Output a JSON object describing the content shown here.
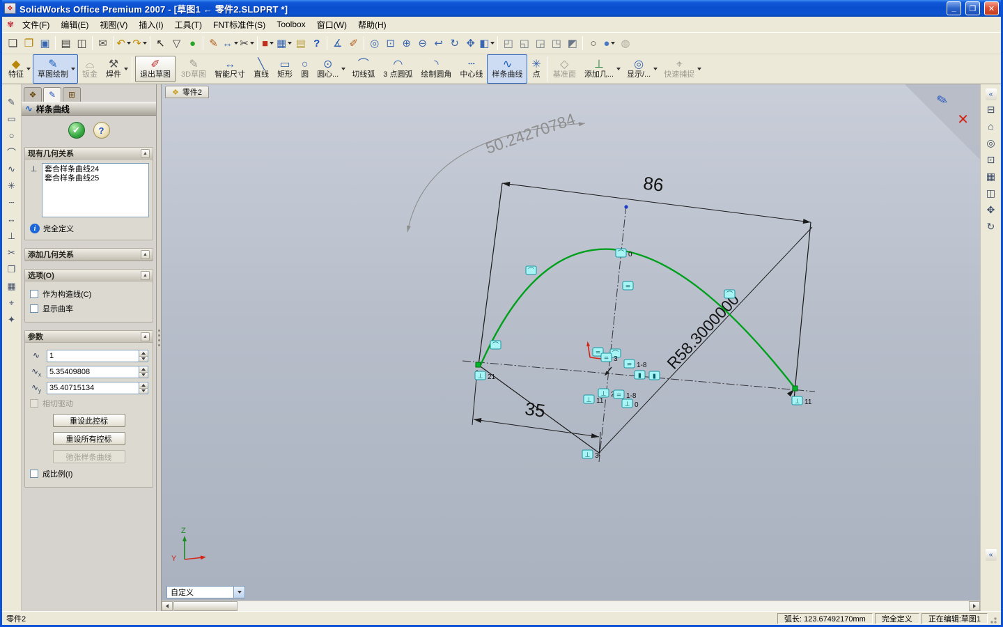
{
  "colors": {
    "titlebar_blue": "#0A53D6",
    "toolbar_bg": "#ECE9D8",
    "panel_bg": "#D6D3CE",
    "graphics_gradient_top": "#C9CED9",
    "graphics_gradient_bottom": "#A9B1BF",
    "spline_green": "#00A01C",
    "relation_cyan": "#A8F4F4",
    "relation_border": "#1794A0",
    "dimension_black": "#141414",
    "driven_dimension_gray": "#8E8E8E",
    "origin_red": "#D42418"
  },
  "titlebar": {
    "title": "SolidWorks Office Premium 2007 - [草图1 ← 零件2.SLDPRT *]",
    "app_icon": "❖",
    "minimize": "_",
    "restore": "❐",
    "close": "✕"
  },
  "menubar": {
    "logo": "✾",
    "items": [
      "文件(F)",
      "编辑(E)",
      "视图(V)",
      "插入(I)",
      "工具(T)",
      "FNT标准件(S)",
      "Toolbox",
      "窗口(W)",
      "帮助(H)"
    ]
  },
  "toolbar1": {
    "buttons": [
      "❏",
      "❐",
      "▣",
      "▤",
      "◫",
      "✉",
      "↶",
      "↷",
      "↖",
      "▽",
      "●",
      "✎",
      "↔",
      "✂",
      "■",
      "▦",
      "▤",
      "?",
      "∡",
      "✐",
      "◎",
      "⊡",
      "⊕",
      "⊖",
      "↩",
      "↻",
      "✥",
      "◧",
      "◰",
      "◱",
      "◲",
      "◳",
      "◩",
      "○",
      "●",
      "◍"
    ]
  },
  "toolbar2": {
    "buttons": [
      {
        "glyph": "◆",
        "label": "特征"
      },
      {
        "glyph": "✎",
        "label": "草图绘制"
      },
      {
        "glyph": "⌓",
        "label": "钣金"
      },
      {
        "glyph": "⚒",
        "label": "焊件"
      },
      {
        "glyph": "✐",
        "label": "退出草图"
      },
      {
        "glyph": "✎",
        "label": "3D草图"
      },
      {
        "glyph": "↔",
        "label": "智能尺寸"
      },
      {
        "glyph": "╲",
        "label": "直线"
      },
      {
        "glyph": "▭",
        "label": "矩形"
      },
      {
        "glyph": "○",
        "label": "圆"
      },
      {
        "glyph": "⊙",
        "label": "圆心..."
      },
      {
        "glyph": "⌒",
        "label": "切线弧"
      },
      {
        "glyph": "◠",
        "label": "3 点圆弧"
      },
      {
        "glyph": "◝",
        "label": "绘制圆角"
      },
      {
        "glyph": "┄",
        "label": "中心线"
      },
      {
        "glyph": "∿",
        "label": "样条曲线"
      },
      {
        "glyph": "✳",
        "label": "点"
      },
      {
        "glyph": "◇",
        "label": "基准面"
      },
      {
        "glyph": "⊥",
        "label": "添加几..."
      },
      {
        "glyph": "◎",
        "label": "显示/..."
      },
      {
        "glyph": "⌖",
        "label": "快速捕捉"
      }
    ]
  },
  "left_toolbar": {
    "buttons": [
      "✎",
      "▭",
      "○",
      "⌒",
      "∿",
      "✳",
      "┄",
      "↔",
      "⊥",
      "✂",
      "❒",
      "▦",
      "⌖",
      "✦"
    ]
  },
  "right_toolbar": {
    "collapse": "«",
    "buttons": [
      "⊟",
      "⌂",
      "◎",
      "⊡",
      "▦",
      "◫",
      "✥",
      "↻"
    ]
  },
  "property_manager": {
    "tabs": [
      "❖",
      "✎",
      "⊞"
    ],
    "title": "样条曲线",
    "title_icon": "∿",
    "ok": "✔",
    "help": "?",
    "chevron": "▲",
    "existing_relations": {
      "header": "现有几何关系",
      "icon": "⊥",
      "items": [
        "套合样条曲线24",
        "套合样条曲线25"
      ],
      "status_icon": "i",
      "status": "完全定义"
    },
    "add_relations": {
      "header": "添加几何关系"
    },
    "options": {
      "header": "选项(O)",
      "construction": "作为构造线(C)",
      "curvature": "显示曲率"
    },
    "parameters": {
      "header": "参数",
      "rows": [
        {
          "icon": "∿",
          "sub": "",
          "value": "1"
        },
        {
          "icon": "∿",
          "sub": "x",
          "value": "5.35409808"
        },
        {
          "icon": "∿",
          "sub": "y",
          "value": "35.40715134"
        }
      ],
      "tangent": "相切驱动",
      "reset_handle": "重设此控标",
      "reset_all": "重设所有控标",
      "relax": "弛张样条曲线",
      "proportional": "成比例(I)"
    }
  },
  "graphics": {
    "doc_tab": {
      "icon": "❖",
      "label": "零件2"
    },
    "dimensions": {
      "width": "86",
      "offset": "35",
      "radius": "R58.3000000",
      "driven": "50.24270784"
    },
    "triad": {
      "up": "Z",
      "side": "Y"
    },
    "relations": [
      {
        "g": "⌒",
        "l": "0"
      },
      {
        "g": "⌒",
        "l": ""
      },
      {
        "g": "⌒",
        "l": ""
      },
      {
        "g": "=",
        "l": ""
      },
      {
        "g": "⌒",
        "l": ""
      },
      {
        "g": "⊥",
        "l": "21"
      },
      {
        "g": "⊥",
        "l": "11"
      },
      {
        "g": "=",
        "l": ""
      },
      {
        "g": "⌒",
        "l": ""
      },
      {
        "g": "=",
        "l": "1-8"
      },
      {
        "g": "▮",
        "l": ""
      },
      {
        "g": "▮",
        "l": ""
      },
      {
        "g": "⊥",
        "l": "11"
      },
      {
        "g": "⊥",
        "l": "21"
      },
      {
        "g": "=",
        "l": "1-8"
      },
      {
        "g": "⊥",
        "l": "0"
      },
      {
        "g": "⊥",
        "l": "3"
      },
      {
        "g": "=",
        "l": "3"
      }
    ],
    "combo": {
      "value": "自定义"
    }
  },
  "statusbar": {
    "doc": "零件2",
    "arc_length": "弧长: 123.67492170mm",
    "state": "完全定义",
    "editing": "正在编辑:草图1"
  }
}
